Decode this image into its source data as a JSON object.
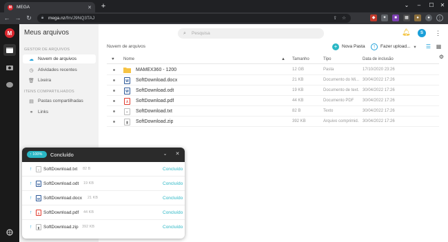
{
  "browser": {
    "tab_title": "MEGA",
    "tab_favicon": "M",
    "new_tab": "+",
    "url_host": "mega.nz",
    "url_path": "/fm/J9NQ3TAJ"
  },
  "app": {
    "title": "Meus arquivos",
    "logo": "M",
    "search_placeholder": "Pesquisa",
    "avatar": "S",
    "accent": "#2ab7c5",
    "brand": "#d9272e"
  },
  "sidebar": {
    "section_files": "GESTOR DE ARQUIVOS",
    "section_shared": "ITENS COMPARTILHADOS",
    "items": [
      {
        "label": "Nuvem de arquivos",
        "icon": "cloud-icon"
      },
      {
        "label": "Atividades recentes",
        "icon": "clock-icon"
      },
      {
        "label": "Lixeira",
        "icon": "trash-icon"
      }
    ],
    "shared_items": [
      {
        "label": "Pastas compartilhadas",
        "icon": "shared-folder-icon"
      },
      {
        "label": "Links",
        "icon": "link-icon"
      }
    ]
  },
  "main": {
    "breadcrumb": "Nuvem de arquivos",
    "new_folder": "Nova Pasta",
    "upload": "Fazer upload...",
    "columns": {
      "name": "Nome",
      "size": "Tamanho",
      "type": "Tipo",
      "date": "Data de inclusão"
    },
    "rows": [
      {
        "name": "MAMEX360 - 1200",
        "size": "12 GB",
        "type": "Pasta",
        "date": "17/10/2020 23:26",
        "icon": "folder-icon"
      },
      {
        "name": "SoftDownload.docx",
        "size": "21 KB",
        "type": "Documento do Mi...",
        "date": "30/04/2022 17:26",
        "icon": "word-icon"
      },
      {
        "name": "SoftDownload.odt",
        "size": "19 KB",
        "type": "Documento de text...",
        "date": "30/04/2022 17:26",
        "icon": "word-icon"
      },
      {
        "name": "SoftDownload.pdf",
        "size": "44 KB",
        "type": "Documento PDF",
        "date": "30/04/2022 17:26",
        "icon": "pdf-icon"
      },
      {
        "name": "SoftDownload.txt",
        "size": "82 B",
        "type": "Texto",
        "date": "30/04/2022 17:26",
        "icon": "text-icon"
      },
      {
        "name": "SoftDownload.zip",
        "size": "392 KB",
        "type": "Arquivo comprimid...",
        "date": "30/04/2022 17:26",
        "icon": "zip-icon"
      }
    ]
  },
  "transfers": {
    "badge": "↑ 100%",
    "title": "Concluído",
    "items": [
      {
        "name": "SoftDownload.txt",
        "size": "82 B",
        "status": "Concluído",
        "icon": "text-icon"
      },
      {
        "name": "SoftDownload.odt",
        "size": "19 KB",
        "status": "Concluído",
        "icon": "word-icon"
      },
      {
        "name": "SoftDownload.docx",
        "size": "21 KB",
        "status": "Concluído",
        "icon": "word-icon"
      },
      {
        "name": "SoftDownload.pdf",
        "size": "44 KB",
        "status": "Concluído",
        "icon": "pdf-icon"
      },
      {
        "name": "SoftDownload.zip",
        "size": "392 KB",
        "status": "Concluído",
        "icon": "zip-icon"
      }
    ]
  }
}
